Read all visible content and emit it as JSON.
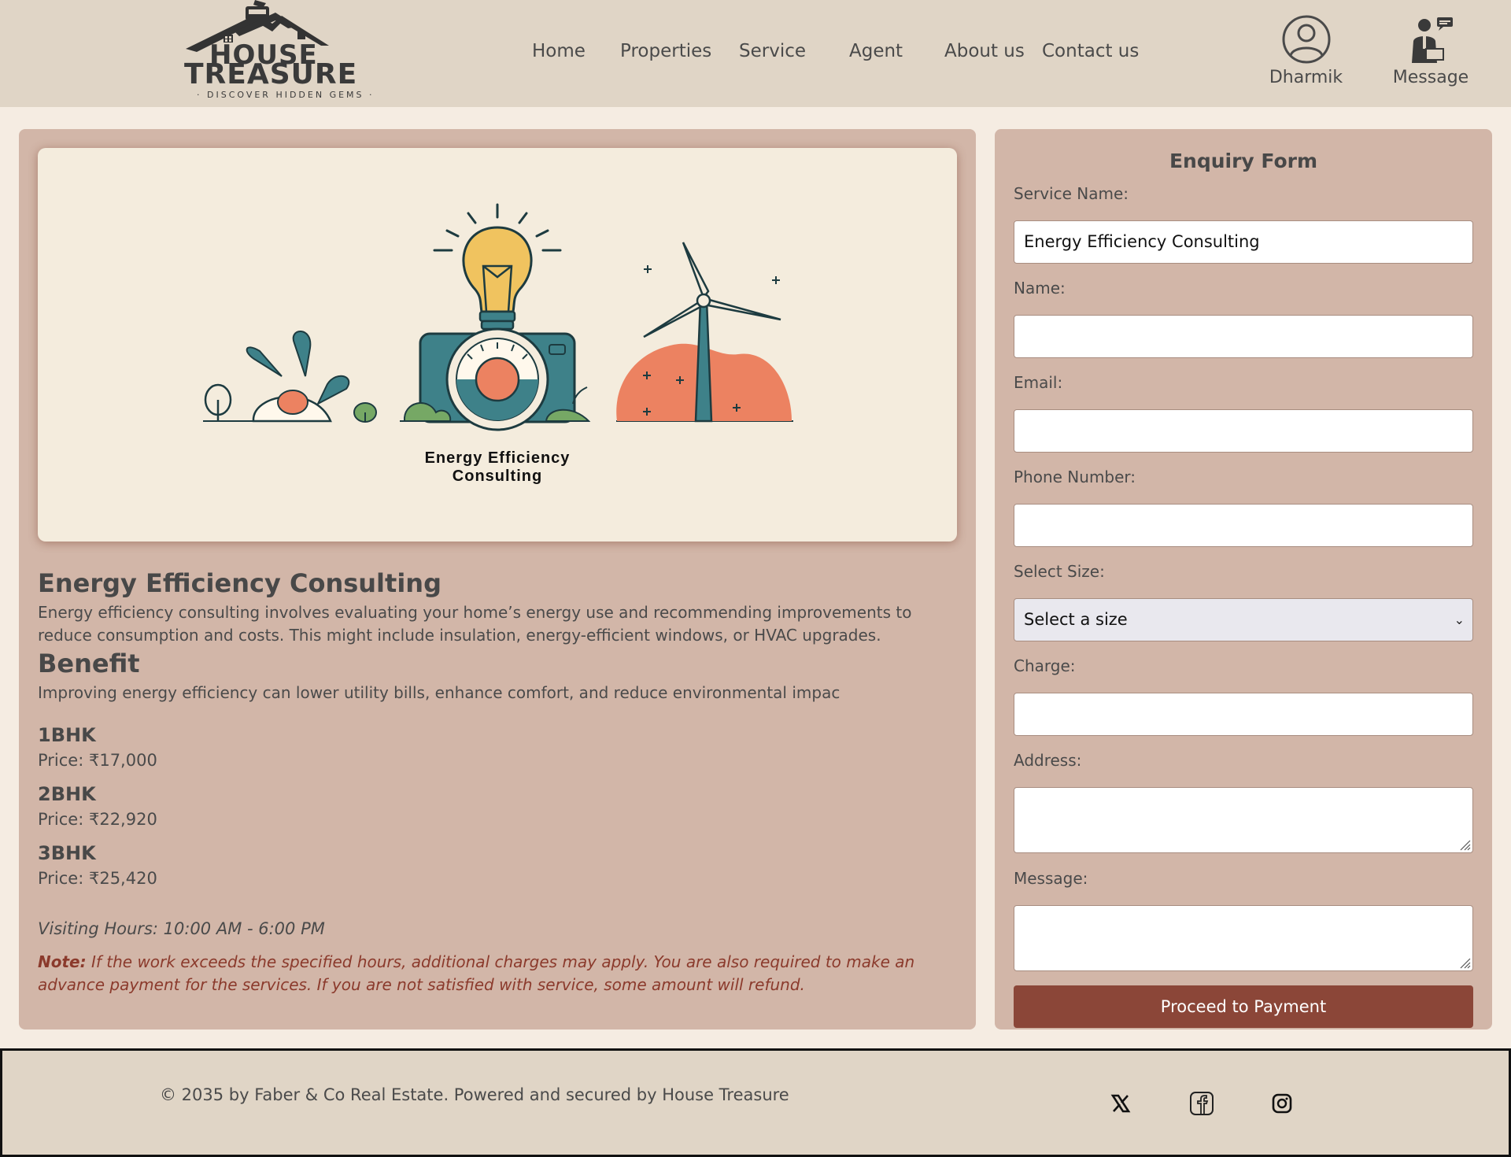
{
  "brand": {
    "line1": "HOUSE",
    "line2": "TREASURE",
    "tagline": "· DISCOVER HIDDEN GEMS ·"
  },
  "nav": {
    "home": "Home",
    "properties": "Properties",
    "service": "Service",
    "agent": "Agent",
    "about": "About us",
    "contact": "Contact us"
  },
  "header_actions": {
    "profile_label": "Dharmik",
    "message_label": "Message"
  },
  "hero": {
    "caption_line1": "Energy Efficiency",
    "caption_line2": "Consulting"
  },
  "service": {
    "title": "Energy Efficiency Consulting",
    "description": "Energy efficiency consulting involves evaluating your home’s energy use and recommending improvements to reduce consumption and costs. This might include insulation, energy-efficient windows, or HVAC upgrades.",
    "benefit_title": "Benefit",
    "benefit_text": "Improving energy efficiency can lower utility bills, enhance comfort, and reduce environmental impac",
    "prices": [
      {
        "size": "1BHK",
        "price": "Price: ₹17,000"
      },
      {
        "size": "2BHK",
        "price": "Price: ₹22,920"
      },
      {
        "size": "3BHK",
        "price": "Price: ₹25,420"
      }
    ],
    "visiting_hours": "Visiting Hours: 10:00 AM - 6:00 PM",
    "note_label": "Note:",
    "note_text": " If the work exceeds the specified hours, additional charges may apply. You are also required to make an advance payment for the services. If you are not satisfied with service, some amount will refund."
  },
  "form": {
    "title": "Enquiry Form",
    "service_name_label": "Service Name:",
    "service_name_value": "Energy Efficiency Consulting",
    "name_label": "Name:",
    "email_label": "Email:",
    "phone_label": "Phone Number:",
    "size_label": "Select Size:",
    "size_selected": "Select a size",
    "charge_label": "Charge:",
    "address_label": "Address:",
    "message_label": "Message:",
    "submit_label": "Proceed to Payment"
  },
  "footer": {
    "copyright": "© 2035 by Faber & Co Real Estate. Powered and secured by House Treasure",
    "social": [
      "x-icon",
      "facebook-icon",
      "instagram-icon"
    ]
  },
  "colors": {
    "header_bg": "#e0d5c6",
    "page_bg": "#f5ece2",
    "panel_bg": "#d2b6a8",
    "button_bg": "#8b4638",
    "note_color": "#8b3a2c",
    "illus_teal": "#3e8189",
    "illus_orange": "#ec8261",
    "illus_yellow": "#f0c35f",
    "illus_green": "#76a865"
  }
}
